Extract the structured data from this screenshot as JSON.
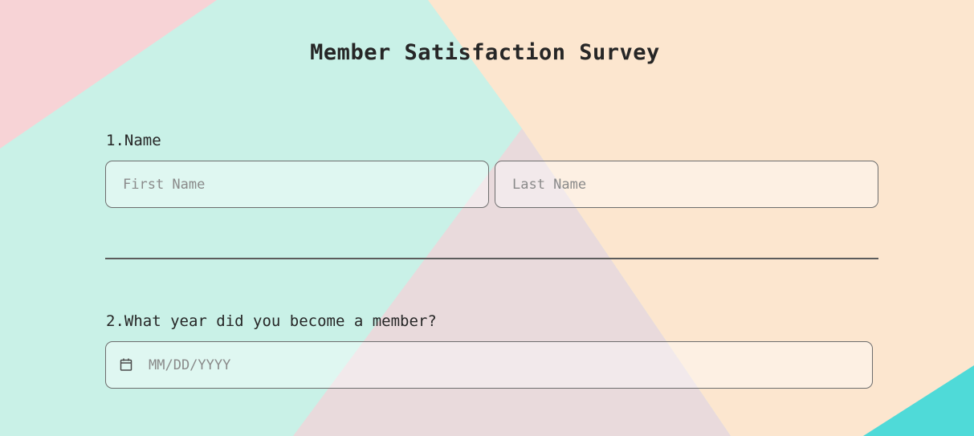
{
  "survey": {
    "title": "Member Satisfaction Survey",
    "questions": [
      {
        "label": "1.Name",
        "fields": [
          {
            "placeholder": "First Name"
          },
          {
            "placeholder": "Last Name"
          }
        ]
      },
      {
        "label": "2.What year did you become a member?",
        "fields": [
          {
            "placeholder": "MM/DD/YYYY",
            "icon": "calendar-icon"
          }
        ]
      }
    ]
  },
  "colors": {
    "background_pink": "#f7d3d6",
    "background_mint": "#c9f1e7",
    "background_peach": "#fce6cf",
    "background_mauve": "#e9dadc",
    "background_turquoise": "#4fdad8",
    "text": "#262626",
    "border": "#6d6d6d"
  }
}
